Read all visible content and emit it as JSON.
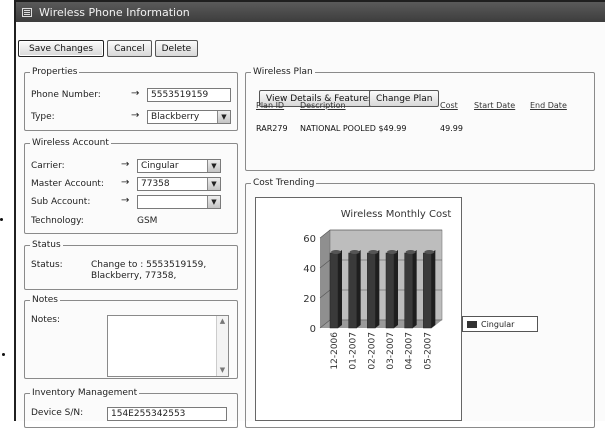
{
  "window": {
    "title": "Wireless Phone Information"
  },
  "toolbar": {
    "save": "Save Changes",
    "cancel": "Cancel",
    "delete": "Delete"
  },
  "properties": {
    "legend": "Properties",
    "phone_label": "Phone Number:",
    "phone_value": "5553519159",
    "type_label": "Type:",
    "type_value": "Blackberry"
  },
  "account": {
    "legend": "Wireless Account",
    "carrier_label": "Carrier:",
    "carrier_value": "Cingular",
    "master_label": "Master Account:",
    "master_value": "77358",
    "sub_label": "Sub Account:",
    "sub_value": "",
    "tech_label": "Technology:",
    "tech_value": "GSM"
  },
  "status": {
    "legend": "Status",
    "label": "Status:",
    "line1": "Change to : 5553519159,",
    "line2": "Blackberry, 77358,"
  },
  "notes": {
    "legend": "Notes",
    "label": "Notes:"
  },
  "inventory": {
    "legend": "Inventory Management",
    "serial_label": "Device S/N:",
    "serial_value": "154E255342553"
  },
  "plan": {
    "legend": "Wireless Plan",
    "view_button": "View Details & Features",
    "change_button": "Change Plan",
    "columns": [
      "Plan ID",
      "Description",
      "Cost",
      "Start Date",
      "End Date"
    ],
    "rows": [
      [
        "RAR279",
        "NATIONAL POOLED $49.99",
        "49.99",
        "",
        ""
      ]
    ]
  },
  "trending": {
    "legend": "Cost Trending"
  },
  "colors": {
    "bar": "#3a3a3a",
    "title_bar": "#4a4a4a"
  },
  "icons": {
    "arrow": "→",
    "dropdown": "▼"
  },
  "chart_data": {
    "type": "bar",
    "title": "Wireless Monthly Cost",
    "categories": [
      "12-2006",
      "01-2007",
      "02-2007",
      "03-2007",
      "04-2007",
      "05-2007"
    ],
    "series": [
      {
        "name": "Cingular",
        "values": [
          50,
          50,
          50,
          50,
          50,
          50
        ]
      }
    ],
    "ylim": [
      0,
      60
    ],
    "yticks": [
      0,
      20,
      40,
      60
    ],
    "legend_position": "right"
  }
}
